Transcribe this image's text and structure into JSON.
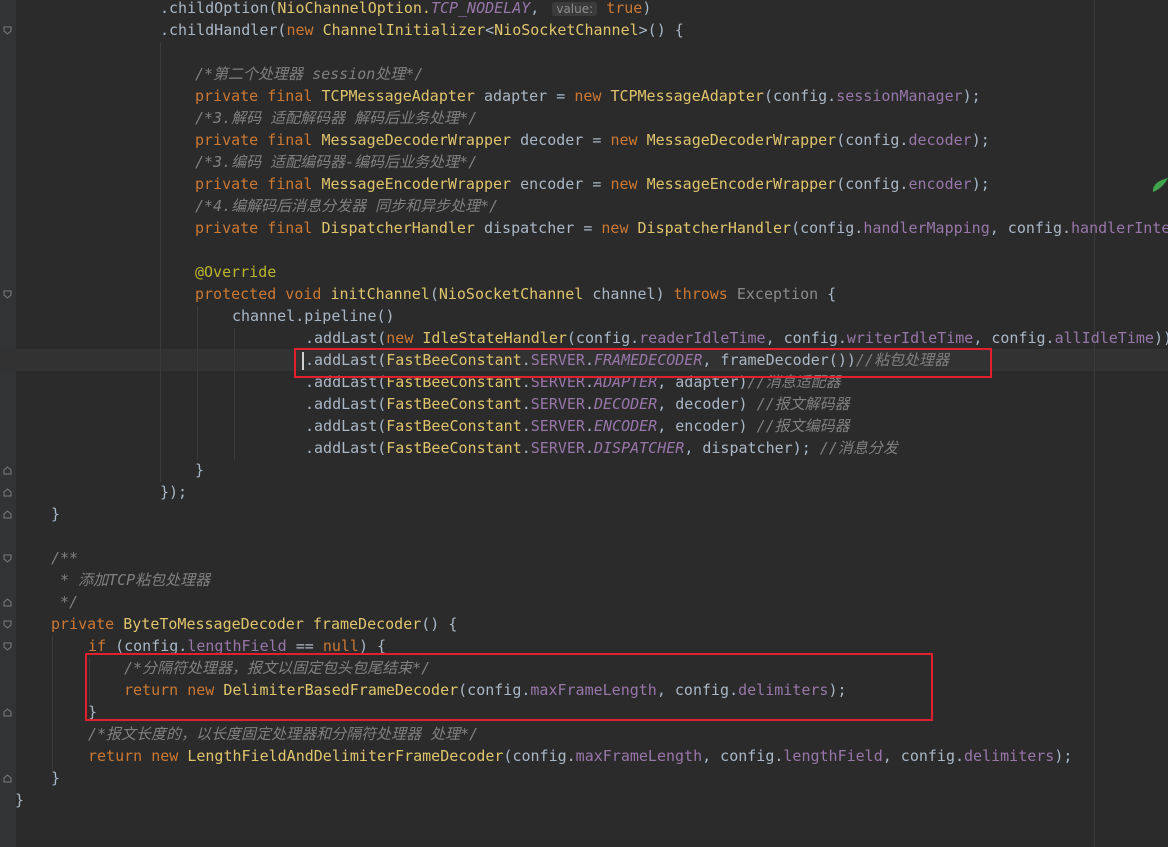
{
  "editor": {
    "language": "java",
    "colors": {
      "background": "#2b2b2b",
      "keyword": "#cc7832",
      "class": "#e0c46c",
      "field": "#9876aa",
      "comment": "#808080",
      "annotation": "#bbb529",
      "highlight_box": "#e0202c"
    },
    "lines": {
      "l0": [
        ".childOption(",
        "NioChannelOption.",
        "TCP_NODELAY",
        ", ",
        "value:",
        " ",
        "true",
        ")"
      ],
      "l1": [
        ".childHandler(",
        "new ",
        "ChannelInitializer",
        "<",
        "NioSocketChannel",
        ">() {"
      ],
      "l3": [
        "/*第二个处理器 session处理*/"
      ],
      "l4": [
        "private final ",
        "TCPMessageAdapter",
        " adapter = ",
        "new ",
        "TCPMessageAdapter",
        "(config.",
        "sessionManager",
        ");"
      ],
      "l5": [
        "/*3.解码 适配解码器 解码后业务处理*/"
      ],
      "l6": [
        "private final ",
        "MessageDecoderWrapper",
        " decoder = ",
        "new ",
        "MessageDecoderWrapper",
        "(config.",
        "decoder",
        ");"
      ],
      "l7": [
        "/*3.编码 适配编码器-编码后业务处理*/"
      ],
      "l8": [
        "private final ",
        "MessageEncoderWrapper",
        " encoder = ",
        "new ",
        "MessageEncoderWrapper",
        "(config.",
        "encoder",
        ");"
      ],
      "l9": [
        "/*4.编解码后消息分发器 同步和异步处理*/"
      ],
      "l10": [
        "private final ",
        "DispatcherHandler",
        " dispatcher = ",
        "new ",
        "DispatcherHandler",
        "(config.",
        "handlerMapping",
        ", config.",
        "handlerInte"
      ],
      "l12": [
        "@Override"
      ],
      "l13": [
        "protected void ",
        "initChannel",
        "(",
        "NioSocketChannel",
        " channel) ",
        "throws ",
        "Exception",
        " {"
      ],
      "l14": [
        "channel.pipeline()"
      ],
      "l15": [
        ".addLast(",
        "new ",
        "IdleStateHandler",
        "(config.",
        "readerIdleTime",
        ", config.",
        "writerIdleTime",
        ", config.",
        "allIdleTime",
        "))"
      ],
      "l16": [
        ".addLast(",
        "FastBeeConstant",
        ".",
        "SERVER",
        ".",
        "FRAMEDECODER",
        ", frameDecoder())",
        "//粘包处理器"
      ],
      "l17": [
        ".addLast(",
        "FastBeeConstant",
        ".",
        "SERVER",
        ".",
        "ADAPTER",
        ", adapter)",
        "//消息适配器"
      ],
      "l18": [
        ".addLast(",
        "FastBeeConstant",
        ".",
        "SERVER",
        ".",
        "DECODER",
        ", decoder) ",
        "//报文解码器"
      ],
      "l19": [
        ".addLast(",
        "FastBeeConstant",
        ".",
        "SERVER",
        ".",
        "ENCODER",
        ", encoder) ",
        "//报文编码器"
      ],
      "l20": [
        ".addLast(",
        "FastBeeConstant",
        ".",
        "SERVER",
        ".",
        "DISPATCHER",
        ", dispatcher); ",
        "//消息分发"
      ],
      "l21": [
        "}"
      ],
      "l22": [
        "});"
      ],
      "l23": [
        "}"
      ],
      "l25": [
        "/**"
      ],
      "l26": [
        " * 添加TCP粘包处理器"
      ],
      "l27": [
        " */"
      ],
      "l28": [
        "private ",
        "ByteToMessageDecoder",
        " ",
        "frameDecoder",
        "() {"
      ],
      "l29": [
        "if ",
        "(config.",
        "lengthField",
        " == ",
        "null",
        ") {"
      ],
      "l30": [
        "/*分隔符处理器，报文以固定包头包尾结束*/"
      ],
      "l31": [
        "return new ",
        "DelimiterBasedFrameDecoder",
        "(config.",
        "maxFrameLength",
        ", config.",
        "delimiters",
        ");"
      ],
      "l32": [
        "}"
      ],
      "l33": [
        "/*报文长度的，以长度固定处理器和分隔符处理器 处理*/"
      ],
      "l34": [
        "return new ",
        "LengthFieldAndDelimiterFrameDecoder",
        "(config.",
        "maxFrameLength",
        ", config.",
        "lengthField",
        ", config.",
        "delimiters",
        ");"
      ],
      "l35": [
        "}"
      ],
      "l36": [
        "}"
      ]
    }
  }
}
